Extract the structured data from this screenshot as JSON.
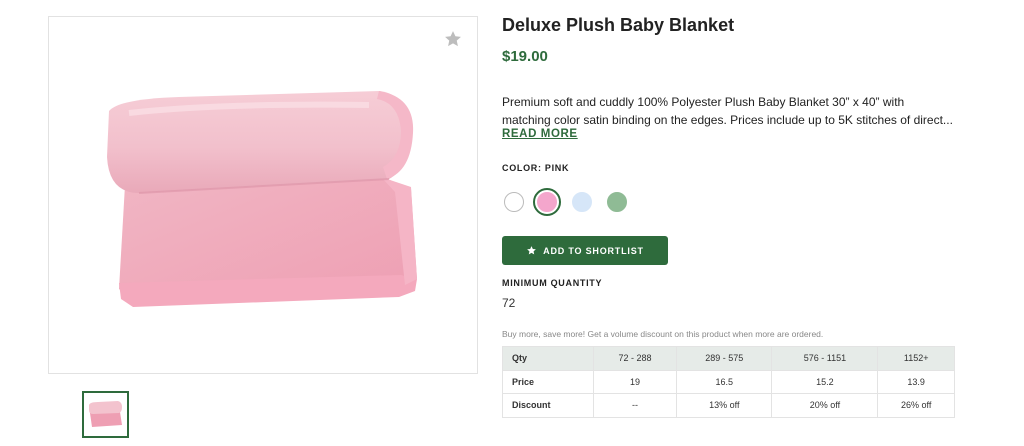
{
  "product": {
    "title": "Deluxe Plush Baby Blanket",
    "price": "$19.00",
    "description_line1": "Premium soft and cuddly 100% Polyester Plush Baby Blanket 30” x 40” with",
    "description_line2": "matching color satin binding on the edges. Prices include up to 5K stitches of direct...",
    "read_more": "READ MORE",
    "image_icon": "rolled-pink-blanket",
    "favorite_icon": "star-icon"
  },
  "color": {
    "label": "COLOR: PINK",
    "swatches": [
      {
        "name": "white",
        "hex": "#ffffff"
      },
      {
        "name": "pink",
        "hex": "#f4a6cc",
        "selected": true
      },
      {
        "name": "blue",
        "hex": "#d6e6f8"
      },
      {
        "name": "green",
        "hex": "#8fbb95"
      }
    ]
  },
  "shortlist": {
    "label": "ADD TO SHORTLIST",
    "icon": "star-icon"
  },
  "minimum_quantity": {
    "label": "MINIMUM QUANTITY",
    "value": "72"
  },
  "volume_note": "Buy more, save more! Get a volume discount on this product when more are ordered.",
  "pricing_table": {
    "rows": [
      {
        "label": "Qty",
        "cells": [
          "72 - 288",
          "289 - 575",
          "576 - 1151",
          "1152+"
        ]
      },
      {
        "label": "Price",
        "cells": [
          "19",
          "16.5",
          "15.2",
          "13.9"
        ]
      },
      {
        "label": "Discount",
        "cells": [
          "--",
          "13% off",
          "20% off",
          "26% off"
        ]
      }
    ]
  },
  "colors": {
    "accent": "#2e6b3c",
    "table_header": "#e6ebe8"
  }
}
